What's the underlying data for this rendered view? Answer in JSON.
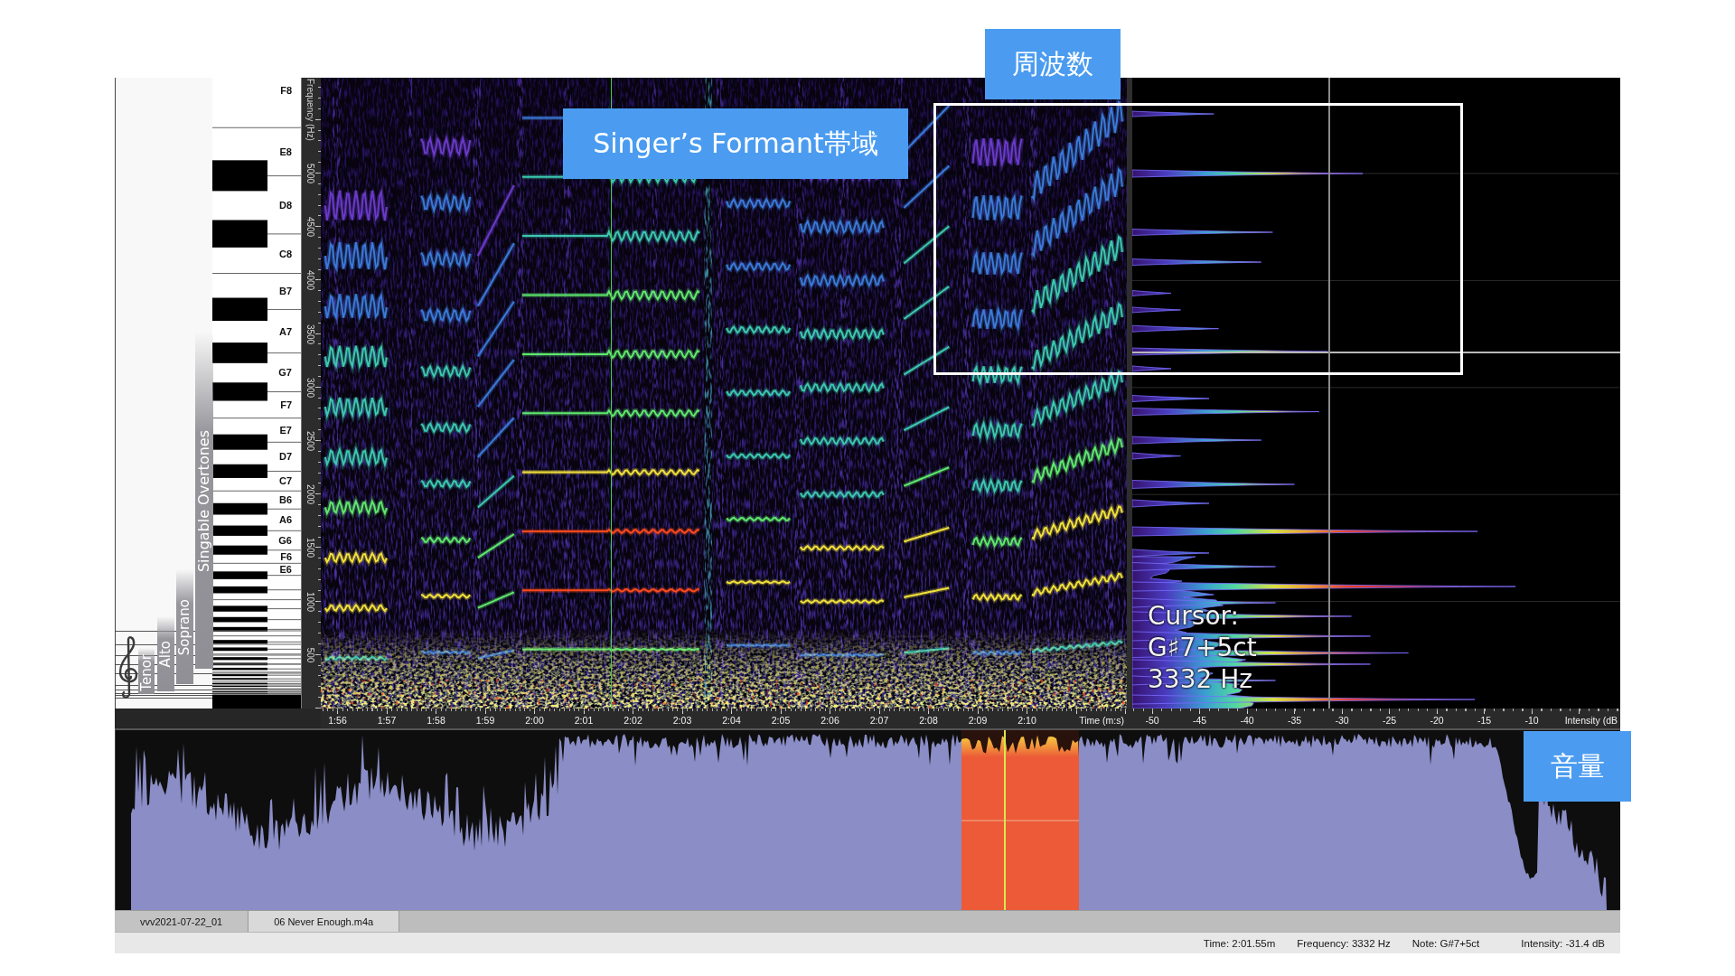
{
  "callouts": [
    {
      "text": "周波数"
    },
    {
      "text": "Singer’s Formant帯域"
    },
    {
      "text": "音量"
    }
  ],
  "voice_ranges": [
    "Singable Overtones",
    "Soprano",
    "Alto",
    "Tenor"
  ],
  "keyboard": {
    "key_labels": [
      "F8",
      "E8",
      "D8",
      "C8",
      "B7",
      "A7",
      "G7",
      "F7",
      "E7",
      "D7",
      "C7",
      "B6",
      "A6",
      "G6",
      "F6",
      "E6"
    ]
  },
  "frequency_axis": {
    "title": "Frequency (Hz)",
    "ticks": [
      "5000",
      "4500",
      "4000",
      "3500",
      "3000",
      "2500",
      "2000",
      "1500",
      "1000",
      "500"
    ]
  },
  "cursor_readout": {
    "label": "Cursor:",
    "note": "G♯7+5ct",
    "frequency": "3332 Hz"
  },
  "time_axis": {
    "ticks": [
      "1:56",
      "1:57",
      "1:58",
      "1:59",
      "2:00",
      "2:01",
      "2:02",
      "2:03",
      "2:04",
      "2:05",
      "2:06",
      "2:07",
      "2:08",
      "2:09",
      "2:10"
    ],
    "title": "Time (m:s)"
  },
  "intensity_axis": {
    "ticks": [
      "-50",
      "-45",
      "-40",
      "-35",
      "-30",
      "-25",
      "-20",
      "-15",
      "-10"
    ],
    "title": "Intensity (dB"
  },
  "tabs": [
    {
      "label": "vvv2021-07-22_01",
      "selected": false
    },
    {
      "label": "06 Never Enough.m4a",
      "selected": true
    }
  ],
  "status_bar": [
    "Time: 2:01.55m",
    "Frequency: 3332 Hz",
    "Note: G#7+5ct",
    "Intensity: -31.4 dB"
  ]
}
